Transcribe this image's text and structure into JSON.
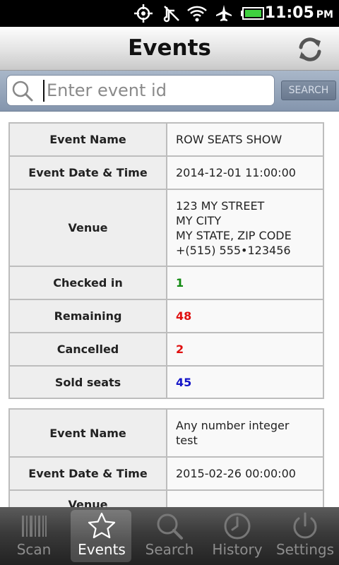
{
  "status_bar": {
    "time": "11:05",
    "ampm": "PM",
    "icons": [
      "gps-icon",
      "silent-icon",
      "wifi-icon",
      "airplane-icon",
      "battery-icon"
    ]
  },
  "header": {
    "title": "Events",
    "refresh_icon": "refresh-icon"
  },
  "search": {
    "placeholder": "Enter event id",
    "button_label": "SEARCH"
  },
  "events": [
    {
      "rows": [
        {
          "label": "Event Name",
          "value_lines": [
            "ROW SEATS SHOW"
          ]
        },
        {
          "label": "Event Date & Time",
          "value_lines": [
            "2014-12-01 11:00:00"
          ]
        },
        {
          "label": "Venue",
          "value_lines": [
            "123 MY STREET",
            "MY CITY",
            "MY STATE, ZIP CODE",
            "+(515) 555•123456"
          ]
        },
        {
          "label": "Checked in",
          "value": "1",
          "color": "#118a11"
        },
        {
          "label": "Remaining",
          "value": "48",
          "color": "#e01010"
        },
        {
          "label": "Cancelled",
          "value": "2",
          "color": "#e01010"
        },
        {
          "label": "Sold seats",
          "value": "45",
          "color": "#1515c8"
        }
      ]
    },
    {
      "rows": [
        {
          "label": "Event Name",
          "value_lines": [
            "Any number integer",
            "test"
          ]
        },
        {
          "label": "Event Date & Time",
          "value_lines": [
            "2015-02-26 00:00:00"
          ]
        },
        {
          "label": "Venue",
          "value_lines": [
            ""
          ]
        }
      ]
    }
  ],
  "tabs": [
    {
      "label": "Scan",
      "icon": "barcode-icon",
      "active": false
    },
    {
      "label": "Events",
      "icon": "star-icon",
      "active": true
    },
    {
      "label": "Search",
      "icon": "search-icon",
      "active": false
    },
    {
      "label": "History",
      "icon": "clock-icon",
      "active": false
    },
    {
      "label": "Settings",
      "icon": "power-icon",
      "active": false
    }
  ]
}
